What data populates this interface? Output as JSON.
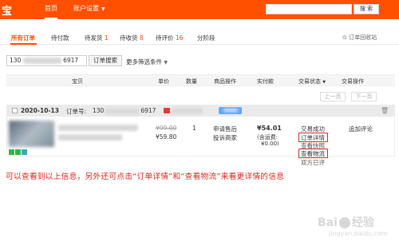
{
  "topbar": {
    "logo": "宝",
    "nav_home": "首页",
    "nav_account": "账户设置",
    "search_button": "搜 索",
    "colors": {
      "brand": "#ff5000"
    }
  },
  "tabs": {
    "all": "所有订单",
    "to_pay": "待付款",
    "to_ship": "待发货",
    "to_ship_count": "1",
    "to_receive": "待收货",
    "to_receive_count": "8",
    "to_review": "待评价",
    "to_review_count": "16",
    "installment": "分阶段",
    "recycle": "订单回收站"
  },
  "filter": {
    "order_input_prefix": "130",
    "order_input_suffix": "6917",
    "search_button": "订单搜索",
    "more_conditions": "更多筛选条件"
  },
  "table": {
    "headers": [
      "宝贝",
      "单价",
      "数量",
      "商品操作",
      "实付款",
      "交易状态",
      "交易操作"
    ],
    "status_dropdown_icon": "chevron-down-icon",
    "prev_page": "上一页",
    "next_page": "下一页"
  },
  "order": {
    "date": "2020-10-13",
    "order_no_label": "订单号:",
    "order_no_prefix": "130",
    "order_no_suffix": "6917",
    "original_price": "¥99.00",
    "price": "¥59.80",
    "quantity": "1",
    "apply_aftersale": "申请售后",
    "complain_seller": "投诉商家",
    "paid_amount": "¥54.01",
    "shipping_label": "(含运费:",
    "shipping_fee": "¥0.00)",
    "status": "交易成功",
    "order_detail": "订单详情",
    "view_snapshot": "查看快照",
    "view_logistics": "查看物流",
    "mutual_review": "双方已评",
    "add_review": "追加评论"
  },
  "caption": "可以查看到以上信息，另外还可点击“订单详情”和“查看物流”来看更详情的信息",
  "watermark": {
    "brand": "Bai",
    "brand2": "经验",
    "url": "jingyan.baidu.com"
  }
}
